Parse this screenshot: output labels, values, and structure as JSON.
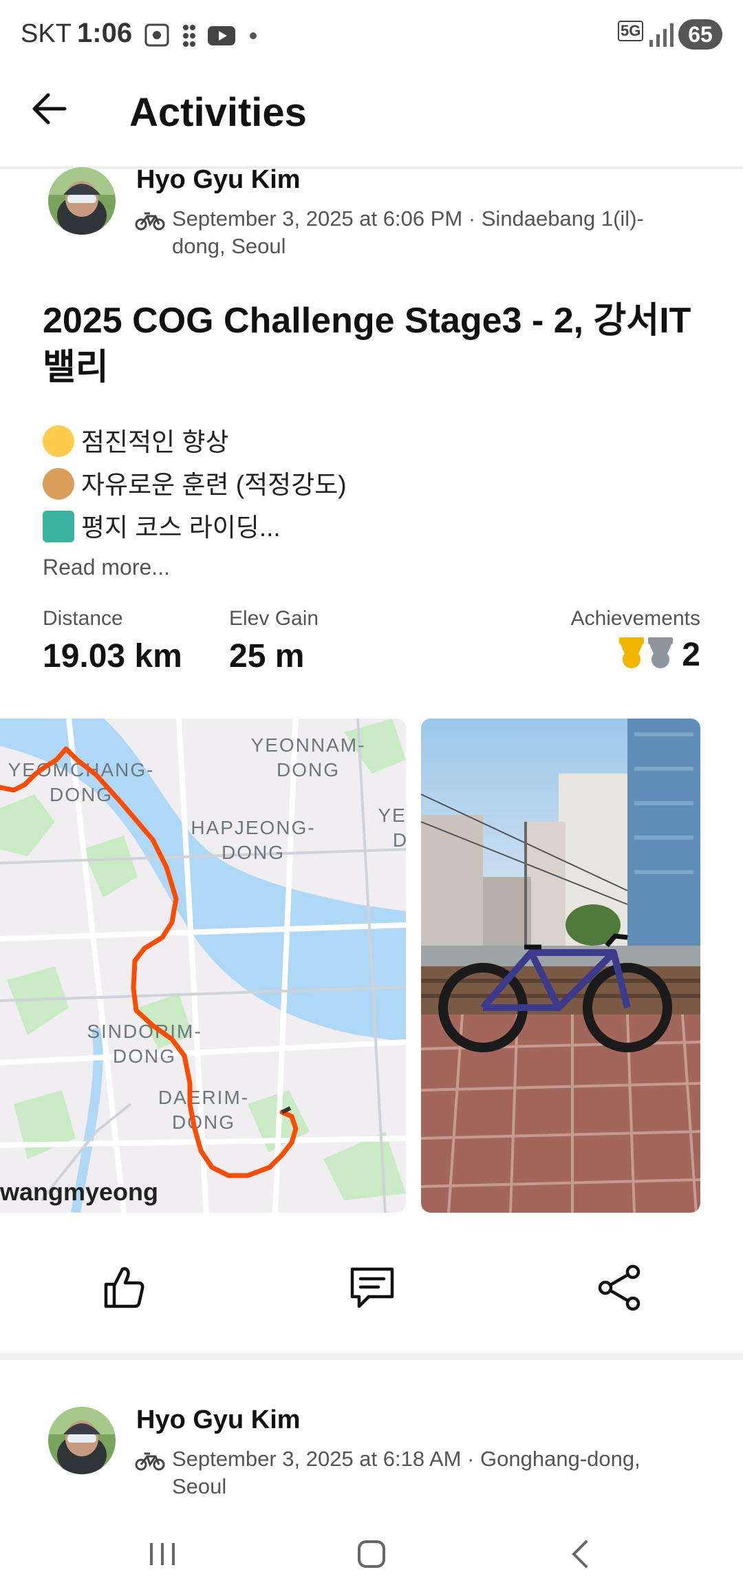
{
  "status_bar": {
    "carrier": "SKT",
    "time": "1:06",
    "network": "5G",
    "battery": "65"
  },
  "header": {
    "title": "Activities"
  },
  "activity": {
    "athlete": "Hyo Gyu Kim",
    "meta": "September 3, 2025 at 6:06 PM · Sindaebang 1(il)-dong, Seoul",
    "title": "2025 COG Challenge Stage3 - 2, 강서IT밸리",
    "description": [
      {
        "emoji": "grin-emoji",
        "text": "점진적인 향상"
      },
      {
        "emoji": "dog-emoji",
        "text": "자유로운 훈련 (적정강도)"
      },
      {
        "emoji": "cyclist-emoji",
        "text": "평지 코스 라이딩..."
      }
    ],
    "read_more": "Read more...",
    "stats": {
      "distance_label": "Distance",
      "distance_value": "19.03 km",
      "elev_label": "Elev Gain",
      "elev_value": "25 m",
      "achievements_label": "Achievements",
      "achievements_value": "2"
    },
    "map": {
      "labels": {
        "yeonnam": "YEONNAM-",
        "yeonnam2": "DONG",
        "yeomchang": "YEOMCHANG-",
        "yeomchang2": "DONG",
        "hapjeong": "HAPJEONG-",
        "hapjeong2": "DONG",
        "ye": "YE",
        "ye2": "D",
        "sindorim": "SINDORIM-",
        "sindorim2": "DONG",
        "daerim": "DAERIM-",
        "daerim2": "DONG",
        "gwangmyeong": "wangmyeong"
      },
      "route_color": "#fc4c02"
    },
    "actions": [
      "like-icon",
      "comment-icon",
      "share-icon"
    ]
  },
  "next_activity": {
    "athlete": "Hyo Gyu Kim",
    "meta": "September 3, 2025 at 6:18 AM · Gonghang-dong, Seoul"
  },
  "colors": {
    "accent": "#fc4c02",
    "gold_medal": "#f2b600",
    "silver_medal": "#8e969c",
    "water": "#aed8f5",
    "park": "#c8ebc3"
  }
}
